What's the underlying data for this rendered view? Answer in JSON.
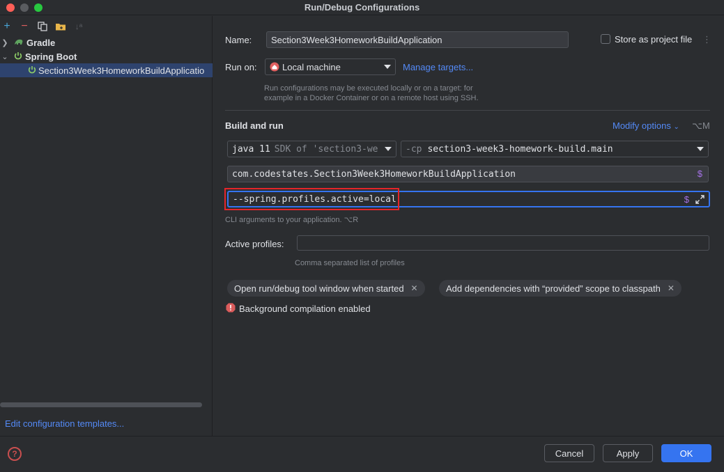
{
  "window": {
    "title": "Run/Debug Configurations"
  },
  "tree": {
    "items": [
      {
        "label": "Gradle",
        "icon": "gradle-icon"
      },
      {
        "label": "Spring Boot",
        "icon": "spring-boot-icon"
      },
      {
        "label": "Section3Week3HomeworkBuildApplicatio",
        "icon": "spring-run-icon"
      }
    ],
    "edit_templates": "Edit configuration templates..."
  },
  "form": {
    "name_label": "Name:",
    "name_value": "Section3Week3HomeworkBuildApplication",
    "store_label": "Store as project file",
    "run_on_label": "Run on:",
    "run_on_value": "Local machine",
    "manage_targets": "Manage targets...",
    "run_on_hint_1": "Run configurations may be executed locally or on a target: for",
    "run_on_hint_2": "example in a Docker Container or on a remote host using SSH.",
    "section_title": "Build and run",
    "modify_options": "Modify options",
    "modify_shortcut": "⌥M",
    "jdk_value": "java 11",
    "jdk_hint": "SDK of 'section3-we",
    "cp_prefix": "-cp",
    "cp_value": "section3-week3-homework-build.main",
    "main_class": "com.codestates.Section3Week3HomeworkBuildApplication",
    "program_args": "--spring.profiles.active=local",
    "program_args_hint": "CLI arguments to your application. ⌥R",
    "active_profiles_label": "Active profiles:",
    "active_profiles_value": "",
    "active_profiles_hint": "Comma separated list of profiles",
    "chips": [
      "Open run/debug tool window when started",
      "Add dependencies with “provided” scope to classpath"
    ],
    "bg_compilation": "Background compilation enabled",
    "dollar": "$"
  },
  "footer": {
    "cancel": "Cancel",
    "apply": "Apply",
    "ok": "OK",
    "help": "?"
  },
  "colors": {
    "accent": "#3574f0",
    "link": "#548af7",
    "highlight_box": "#e5252a"
  }
}
